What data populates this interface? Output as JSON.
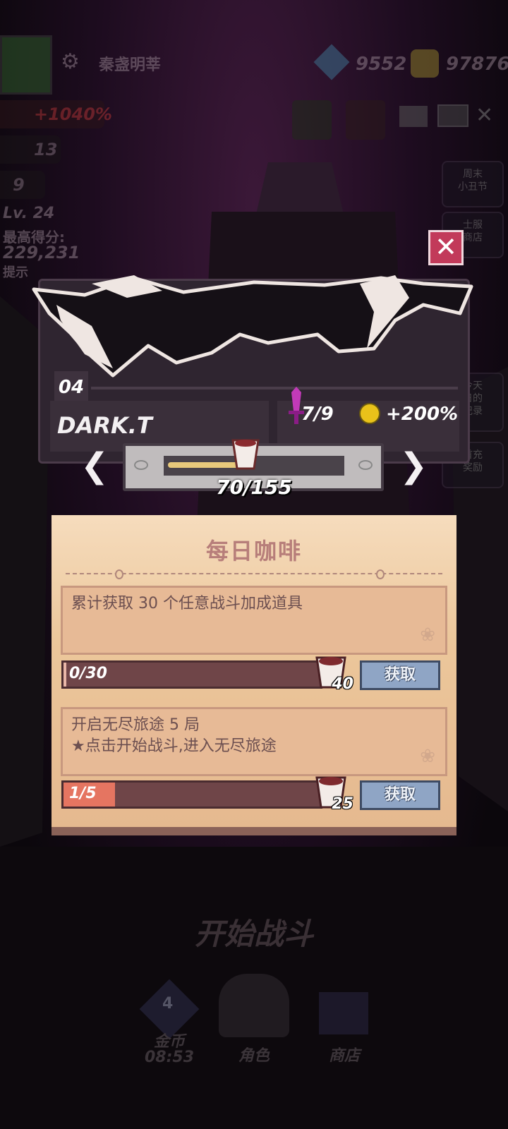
{
  "hud": {
    "player_name": "秦盏明莘",
    "gems": "9552",
    "coins": "97876",
    "bonus_percent": "+1040%",
    "stat_13": "13",
    "stat_9": "9",
    "level": "Lv. 24",
    "score_label": "最高得分:",
    "score": "229,231",
    "hint": "提示",
    "top_icons": [
      "任务\n书籍",
      "每日\n咖啡"
    ],
    "side_buttons": [
      "周末\n小丑节",
      "士服\n商店",
      "今天\n日的\n记录",
      "首充\n奖励"
    ]
  },
  "card": {
    "number": "04",
    "name": "DARK.T",
    "sword_stat": "7/9",
    "bonus": "+200%"
  },
  "progress": {
    "label": "70/155",
    "current": 70,
    "max": 155,
    "prev_arrow": "❮",
    "next_arrow": "❯"
  },
  "close_label": "✕",
  "panel": {
    "title": "每日咖啡",
    "tasks": [
      {
        "text": "累计获取 30 个任意战斗加成道具",
        "sub": "",
        "progress": "0/30",
        "ratio": 0,
        "reward": "40",
        "button": "获取"
      },
      {
        "text": "开启无尽旅途 5 局",
        "sub": "★点击开始战斗,进入无尽旅途",
        "progress": "1/5",
        "ratio": 0.2,
        "reward": "25",
        "button": "获取"
      }
    ]
  },
  "bottom": {
    "start": "开始战斗",
    "nav": [
      {
        "label": "金币\n08:53",
        "badge": "4"
      },
      {
        "label": "角色",
        "badge": ""
      },
      {
        "label": "商店",
        "badge": ""
      }
    ]
  },
  "colors": {
    "accent_red": "#c23a5a",
    "panel_bg": "#ecc79b",
    "button_blue": "#8fa5c5",
    "bar_fill": "#e57561"
  }
}
